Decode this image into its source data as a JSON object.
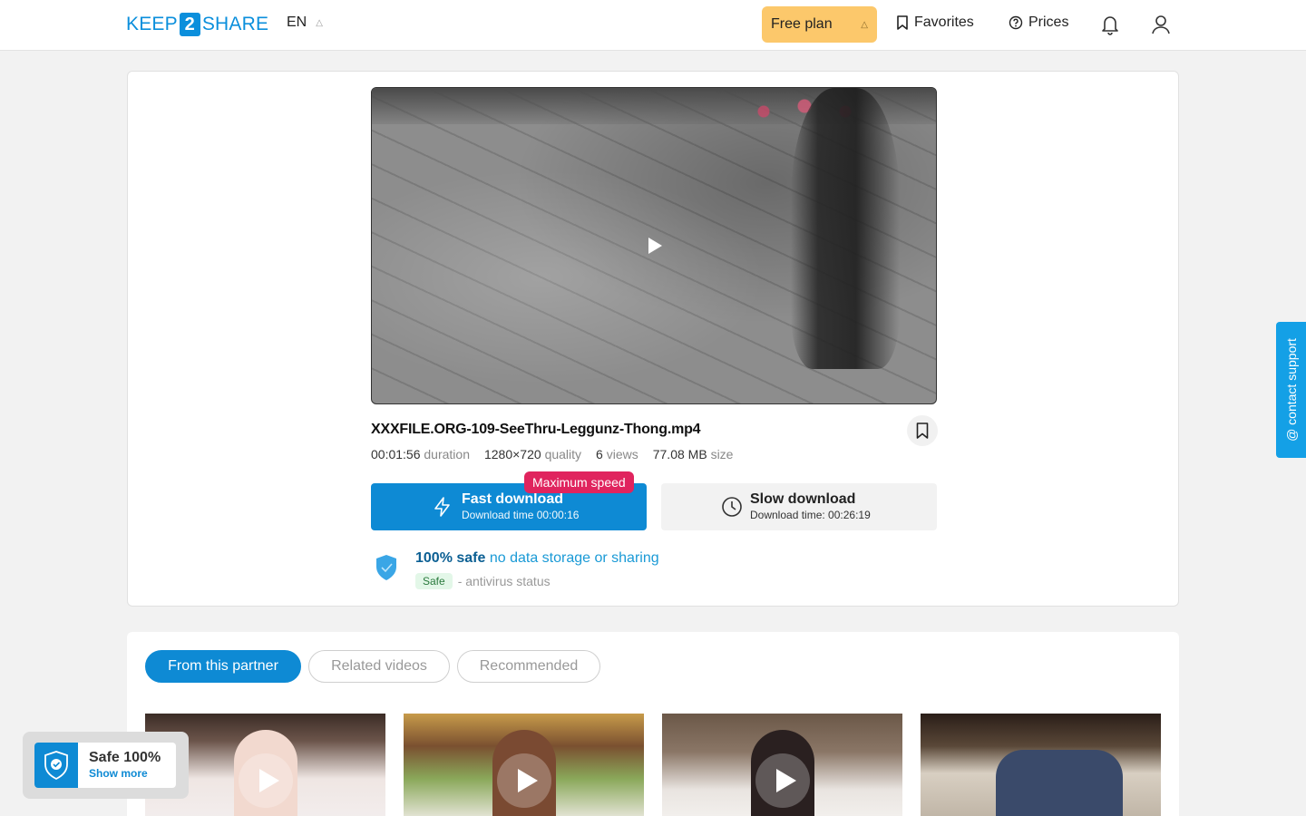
{
  "header": {
    "logo_left": "KEEP",
    "logo_mid": "2",
    "logo_right": "SHARE",
    "language": "EN",
    "plan_label": "Free plan",
    "favorites_label": "Favorites",
    "prices_label": "Prices"
  },
  "file": {
    "name": "XXXFILE.ORG-109-SeeThru-Leggunz-Thong.mp4",
    "duration_value": "00:01:56",
    "duration_label": "duration",
    "quality_value": "1280×720",
    "quality_label": "quality",
    "views_value": "6",
    "views_label": "views",
    "size_value": "77.08 MB",
    "size_label": "size"
  },
  "download": {
    "fast_title": "Fast download",
    "fast_sub": "Download time 00:00:16",
    "fast_badge": "Maximum speed",
    "slow_title": "Slow download",
    "slow_sub": "Download time: 00:26:19"
  },
  "safety": {
    "safe_bold": "100% safe",
    "safe_rest": "no data storage or sharing",
    "av_badge": "Safe",
    "av_text": "- antivirus status"
  },
  "tabs": [
    {
      "label": "From this partner",
      "active": true
    },
    {
      "label": "Related videos",
      "active": false
    },
    {
      "label": "Recommended",
      "active": false
    }
  ],
  "support_label": "@ contact support",
  "safe_popup": {
    "title": "Safe 100%",
    "link": "Show more"
  },
  "colors": {
    "brand_blue": "#0e8ad4",
    "plan_yellow": "#fcc86b",
    "badge_pink": "#e0245e",
    "support_blue": "#14a0e6"
  }
}
